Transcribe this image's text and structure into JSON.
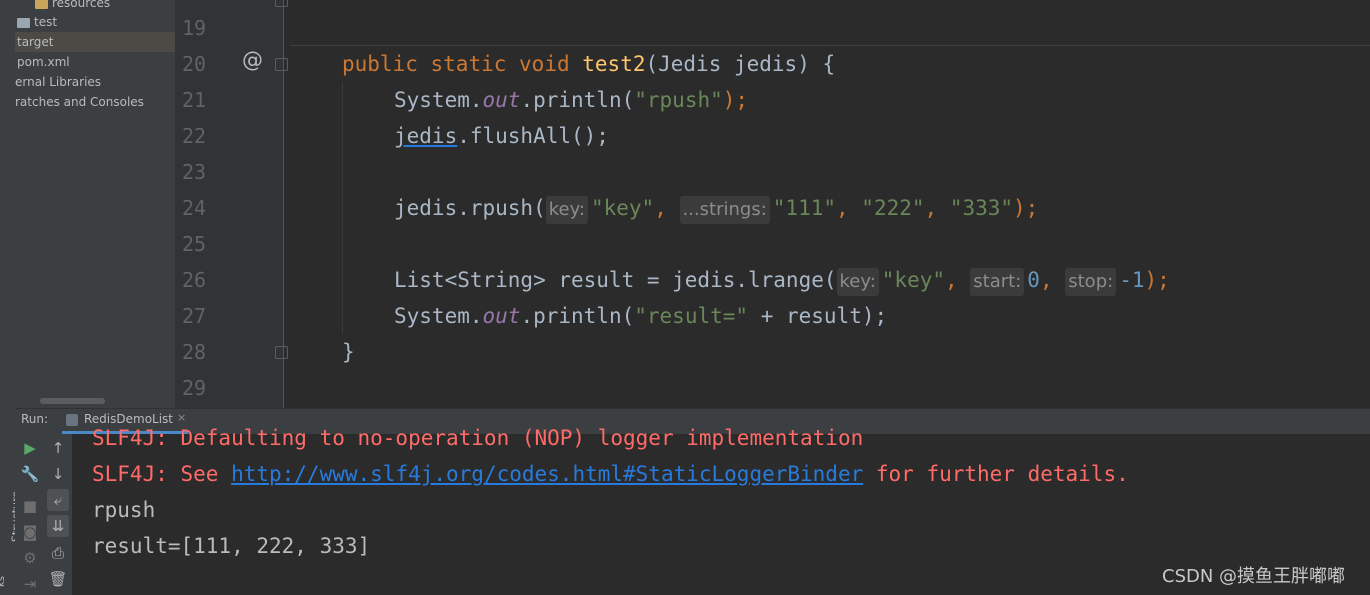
{
  "project_tree": {
    "items": [
      {
        "label": "resources",
        "icon": "resources-folder-icon"
      },
      {
        "label": "test",
        "icon": "folder-icon"
      },
      {
        "label": "target",
        "icon": "folder-icon",
        "selected": true
      },
      {
        "label": "pom.xml",
        "icon": "maven-file-icon"
      },
      {
        "label": "ernal Libraries",
        "icon": "library-icon"
      },
      {
        "label": "ratches and Consoles",
        "icon": "scratch-icon"
      }
    ]
  },
  "side_labels": {
    "structure": "Structure",
    "bookmarks": "ks"
  },
  "editor": {
    "line_numbers": [
      "19",
      "20",
      "21",
      "22",
      "23",
      "24",
      "25",
      "26",
      "27",
      "28",
      "29"
    ],
    "gutter_icon": "@",
    "code": {
      "line20": {
        "kw1": "public",
        "kw2": "static",
        "kw3": "void",
        "method": "test2",
        "params": "(Jedis jedis) {"
      },
      "line21": {
        "pre": "System.",
        "field": "out",
        "mid": ".println(",
        "str": "\"rpush\"",
        "end": ");"
      },
      "line22": {
        "field": "jedis",
        "rest": ".flushAll();"
      },
      "line24": {
        "pre": "jedis.rpush(",
        "hint1": "key:",
        "str1": "\"key\"",
        "comma1": ", ",
        "hint2": "...strings:",
        "str2": "\"111\"",
        "c2": ", ",
        "str3": "\"222\"",
        "c3": ", ",
        "str4": "\"333\"",
        "end": ");"
      },
      "line26": {
        "pre": "List<String> result = jedis.lrange(",
        "hint1": "key:",
        "str1": "\"key\"",
        "c1": ", ",
        "hint2": "start:",
        "num1": "0",
        "c2": ", ",
        "hint3": "stop:",
        "num2": "-1",
        "end": ");"
      },
      "line27": {
        "pre": "System.",
        "field": "out",
        "mid": ".println(",
        "str": "\"result=\"",
        "end": " + result);"
      },
      "line28": {
        "brace": "}"
      }
    }
  },
  "run_panel": {
    "label": "Run:",
    "tab_label": "RedisDemoList",
    "tab_close": "×",
    "console": {
      "line1": "SLF4J: Defaulting to no-operation (NOP) logger implementation",
      "line2_pre": "SLF4J: See ",
      "line2_link": "http://www.slf4j.org/codes.html#StaticLoggerBinder",
      "line2_post": " for further details.",
      "line3": "rpush",
      "line4": "result=[111, 222, 333]"
    }
  },
  "watermark": "CSDN @摸鱼王胖嘟嘟",
  "colors": {
    "keyword": "#cc7832",
    "string": "#6a8759",
    "number": "#6897bb",
    "error": "#ff6b68",
    "link": "#287bde"
  }
}
